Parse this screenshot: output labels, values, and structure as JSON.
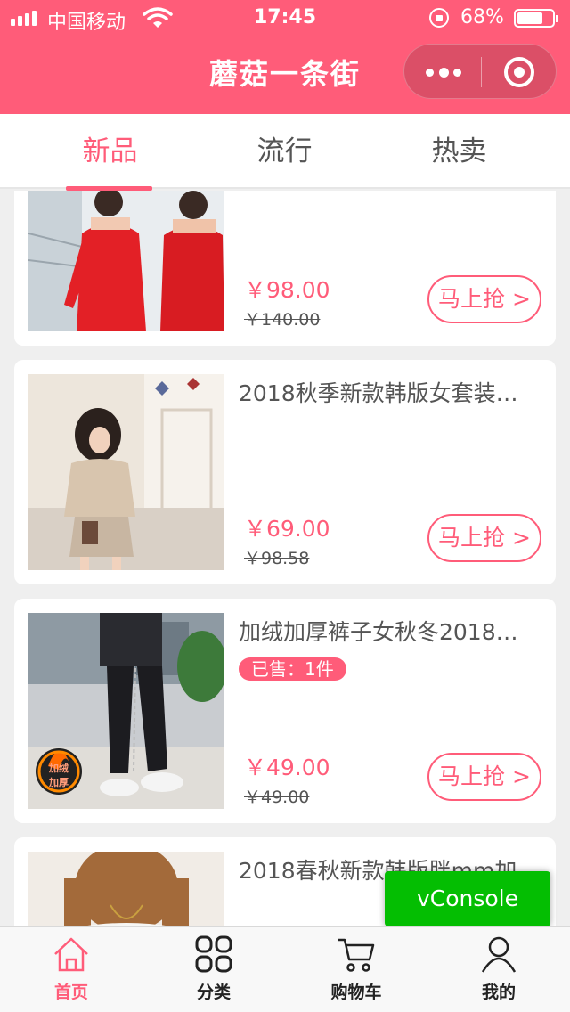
{
  "status_bar": {
    "carrier": "中国移动",
    "time": "17:45",
    "battery_percent": "68%"
  },
  "header": {
    "title": "蘑菇一条街"
  },
  "tabs": [
    {
      "label": "新品",
      "active": true
    },
    {
      "label": "流行",
      "active": false
    },
    {
      "label": "热卖",
      "active": false
    }
  ],
  "products": [
    {
      "name": "",
      "sold": "",
      "price": "￥98.00",
      "original_price": "￥140.00",
      "buy_label": "马上抢 >"
    },
    {
      "name": "2018秋季新款韩版女套装…",
      "sold": "",
      "price": "￥69.00",
      "original_price": "￥98.58",
      "buy_label": "马上抢 >"
    },
    {
      "name": "加绒加厚裤子女秋冬2018…",
      "sold": "已售：1件",
      "price": "￥49.00",
      "original_price": "￥49.00",
      "buy_label": "马上抢 >"
    },
    {
      "name": "2018春秋新款韩版胖mm加",
      "sold": "",
      "price": "",
      "original_price": "",
      "buy_label": ""
    }
  ],
  "thumb_badge": "加绒加厚",
  "vconsole": "vConsole",
  "tabbar": [
    {
      "label": "首页",
      "icon": "home-icon",
      "active": true
    },
    {
      "label": "分类",
      "icon": "category-icon",
      "active": false
    },
    {
      "label": "购物车",
      "icon": "cart-icon",
      "active": false
    },
    {
      "label": "我的",
      "icon": "user-icon",
      "active": false
    }
  ],
  "colors": {
    "brand": "#ff5c79",
    "vconsole": "#04be02"
  }
}
